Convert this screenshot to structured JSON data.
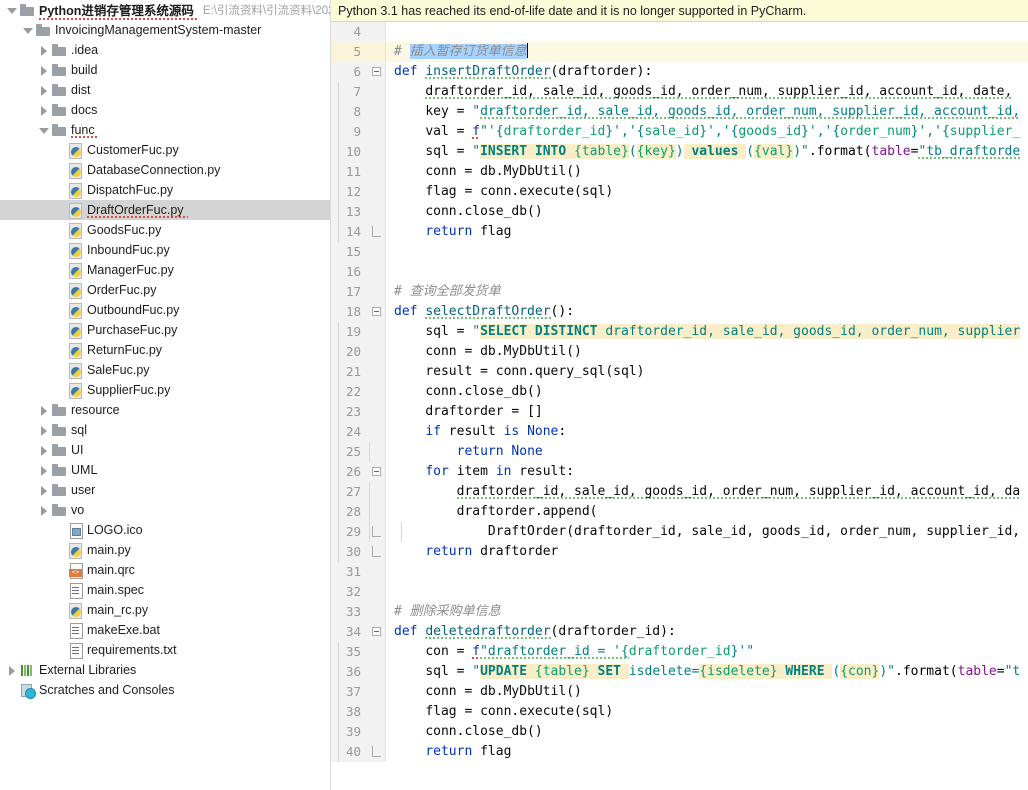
{
  "notification": {
    "message": "Python 3.1 has reached its end-of-life date and it is no longer supported in PyCharm."
  },
  "project_tree": {
    "title": "Python进销存管理系统源码",
    "path": "E:\\引流资料\\引流资料\\202",
    "items": [
      {
        "label": "Python进销存管理系统源码",
        "icon": "folder-icon",
        "arrow": "down",
        "indent": 0,
        "bold": true,
        "squiggle": true,
        "path": "E:\\引流资料\\引流资料\\202"
      },
      {
        "label": "InvoicingManagementSystem-master",
        "icon": "folder-icon",
        "arrow": "down",
        "indent": 1
      },
      {
        "label": ".idea",
        "icon": "folder-icon",
        "arrow": "right",
        "indent": 2
      },
      {
        "label": "build",
        "icon": "folder-icon",
        "arrow": "right",
        "indent": 2
      },
      {
        "label": "dist",
        "icon": "folder-icon",
        "arrow": "right",
        "indent": 2
      },
      {
        "label": "docs",
        "icon": "folder-icon",
        "arrow": "right",
        "indent": 2
      },
      {
        "label": "func",
        "icon": "folder-icon",
        "arrow": "down",
        "indent": 2,
        "squiggle": true
      },
      {
        "label": "CustomerFuc.py",
        "icon": "python-file-icon",
        "arrow": "none",
        "indent": 3
      },
      {
        "label": "DatabaseConnection.py",
        "icon": "python-file-icon",
        "arrow": "none",
        "indent": 3
      },
      {
        "label": "DispatchFuc.py",
        "icon": "python-file-icon",
        "arrow": "none",
        "indent": 3
      },
      {
        "label": "DraftOrderFuc.py",
        "icon": "python-file-icon",
        "arrow": "none",
        "indent": 3,
        "selected": true,
        "squiggle": true
      },
      {
        "label": "GoodsFuc.py",
        "icon": "python-file-icon",
        "arrow": "none",
        "indent": 3
      },
      {
        "label": "InboundFuc.py",
        "icon": "python-file-icon",
        "arrow": "none",
        "indent": 3
      },
      {
        "label": "ManagerFuc.py",
        "icon": "python-file-icon",
        "arrow": "none",
        "indent": 3
      },
      {
        "label": "OrderFuc.py",
        "icon": "python-file-icon",
        "arrow": "none",
        "indent": 3
      },
      {
        "label": "OutboundFuc.py",
        "icon": "python-file-icon",
        "arrow": "none",
        "indent": 3
      },
      {
        "label": "PurchaseFuc.py",
        "icon": "python-file-icon",
        "arrow": "none",
        "indent": 3
      },
      {
        "label": "ReturnFuc.py",
        "icon": "python-file-icon",
        "arrow": "none",
        "indent": 3
      },
      {
        "label": "SaleFuc.py",
        "icon": "python-file-icon",
        "arrow": "none",
        "indent": 3
      },
      {
        "label": "SupplierFuc.py",
        "icon": "python-file-icon",
        "arrow": "none",
        "indent": 3
      },
      {
        "label": "resource",
        "icon": "folder-icon",
        "arrow": "right",
        "indent": 2
      },
      {
        "label": "sql",
        "icon": "folder-icon",
        "arrow": "right",
        "indent": 2
      },
      {
        "label": "UI",
        "icon": "folder-icon",
        "arrow": "right",
        "indent": 2
      },
      {
        "label": "UML",
        "icon": "folder-icon",
        "arrow": "right",
        "indent": 2
      },
      {
        "label": "user",
        "icon": "folder-icon",
        "arrow": "right",
        "indent": 2
      },
      {
        "label": "vo",
        "icon": "folder-icon",
        "arrow": "right",
        "indent": 2
      },
      {
        "label": "LOGO.ico",
        "icon": "image-file-icon",
        "arrow": "none",
        "indent": 3
      },
      {
        "label": "main.py",
        "icon": "python-file-icon",
        "arrow": "none",
        "indent": 3
      },
      {
        "label": "main.qrc",
        "icon": "qrc-file-icon",
        "arrow": "none",
        "indent": 3
      },
      {
        "label": "main.spec",
        "icon": "text-file-icon",
        "arrow": "none",
        "indent": 3
      },
      {
        "label": "main_rc.py",
        "icon": "python-file-icon",
        "arrow": "none",
        "indent": 3
      },
      {
        "label": "makeExe.bat",
        "icon": "text-file-icon",
        "arrow": "none",
        "indent": 3
      },
      {
        "label": "requirements.txt",
        "icon": "text-file-icon",
        "arrow": "none",
        "indent": 3
      },
      {
        "label": "External Libraries",
        "icon": "external-libraries-icon",
        "arrow": "right",
        "indent": 0
      },
      {
        "label": "Scratches and Consoles",
        "icon": "scratches-icon",
        "arrow": "none",
        "indent": 0
      }
    ]
  },
  "editor": {
    "file": "DraftOrderFuc.py",
    "first_line_number": 4,
    "current_line": 5,
    "selection_text": "插入暂存订货单信息",
    "lines": [
      {
        "n": 4,
        "fold": "",
        "indent": 0,
        "html": ""
      },
      {
        "n": 5,
        "fold": "",
        "indent": 0,
        "current": true,
        "html": "<span class=\"cmt\">#</span> <span class=\"sel cmt\">插入暂存订货单信息</span><span class=\"caret\"></span>"
      },
      {
        "n": 6,
        "fold": "start",
        "indent": 0,
        "html": "<span class=\"kw\">def</span> <span class=\"fn squig\">insertDraftOrder</span>(<span class=\"plain\">draftorder</span>):"
      },
      {
        "n": 7,
        "fold": "",
        "indent": 1,
        "html": "    <span class=\"plain squig\">draftorder_id, sale_id, goods_id, order_num, supplier_id, account_id, date,</span>"
      },
      {
        "n": 8,
        "fold": "",
        "indent": 1,
        "html": "    <span class=\"plain\">key</span> = <span class=\"str\">\"</span><span class=\"str squig\">draftorder_id, sale_id, goods_id, order_num, supplier_id, account_id,</span>"
      },
      {
        "n": 9,
        "fold": "",
        "indent": 1,
        "html": "    <span class=\"plain\">val</span> = <span class=\"fpfx squigr\">f</span><span class=\"str\">\"'{</span><span class=\"sqlph\">draftorder_id</span><span class=\"str\">}','{</span><span class=\"sqlph\">sale_id</span><span class=\"str\">}','{</span><span class=\"sqlph\">goods_id</span><span class=\"str\">}','{</span><span class=\"sqlph\">order_num</span><span class=\"str\">}','{</span><span class=\"sqlph\">supplier_</span>"
      },
      {
        "n": 10,
        "fold": "",
        "indent": 1,
        "html": "    <span class=\"plain\">sql</span> = <span class=\"str\">\"</span><span class=\"strk hl\">INSERT INTO </span><span class=\"sqlph hl\">{table}</span><span class=\"str\">(</span><span class=\"sqlph hl\">{key}</span><span class=\"str\">)</span><span class=\"strk hl\"> values </span><span class=\"str\">(</span><span class=\"sqlph hl\">{val}</span><span class=\"str\">)\"</span>.format(<span class=\"param\">table</span>=<span class=\"str squig\">\"tb_draftorde</span>"
      },
      {
        "n": 11,
        "fold": "",
        "indent": 1,
        "html": "    <span class=\"plain\">conn</span> = <span class=\"plain\">db.MyDbUtil()</span>"
      },
      {
        "n": 12,
        "fold": "",
        "indent": 1,
        "html": "    <span class=\"plain\">flag</span> = <span class=\"plain\">conn.execute(sql)</span>"
      },
      {
        "n": 13,
        "fold": "",
        "indent": 1,
        "html": "    <span class=\"plain\">conn.close_db()</span>"
      },
      {
        "n": 14,
        "fold": "end",
        "indent": 1,
        "html": "    <span class=\"kw\">return</span> <span class=\"plain\">flag</span>"
      },
      {
        "n": 15,
        "fold": "",
        "indent": 0,
        "html": ""
      },
      {
        "n": 16,
        "fold": "",
        "indent": 0,
        "html": ""
      },
      {
        "n": 17,
        "fold": "",
        "indent": 0,
        "html": "<span class=\"cmt\"># 查询全部发货单</span>"
      },
      {
        "n": 18,
        "fold": "start",
        "indent": 0,
        "html": "<span class=\"kw\">def</span> <span class=\"fn squig\">selectDraftOrder</span>():"
      },
      {
        "n": 19,
        "fold": "",
        "indent": 1,
        "html": "    <span class=\"plain\">sql</span> = <span class=\"str\">\"</span><span class=\"strk hl\">SELECT DISTINCT </span><span class=\"str hl\">draftorder_id, sale_id, goods_id, order_num, supplier</span>"
      },
      {
        "n": 20,
        "fold": "",
        "indent": 1,
        "html": "    <span class=\"plain\">conn</span> = <span class=\"plain\">db.MyDbUtil()</span>"
      },
      {
        "n": 21,
        "fold": "",
        "indent": 1,
        "html": "    <span class=\"plain\">result</span> = <span class=\"plain\">conn.query_sql(sql)</span>"
      },
      {
        "n": 22,
        "fold": "",
        "indent": 1,
        "html": "    <span class=\"plain\">conn.close_db()</span>"
      },
      {
        "n": 23,
        "fold": "",
        "indent": 1,
        "html": "    <span class=\"plain\">draftorder</span> = []"
      },
      {
        "n": 24,
        "fold": "",
        "indent": 1,
        "html": "    <span class=\"kw\">if</span> <span class=\"plain\">result</span> <span class=\"kw\">is</span> <span class=\"kw\">None</span>:"
      },
      {
        "n": 25,
        "fold": "",
        "indent": 2,
        "html": "        <span class=\"kw\">return</span> <span class=\"kw\">None</span>"
      },
      {
        "n": 26,
        "fold": "start",
        "indent": 1,
        "html": "    <span class=\"kw\">for</span> <span class=\"plain\">item</span> <span class=\"kw\">in</span> <span class=\"plain\">result</span>:"
      },
      {
        "n": 27,
        "fold": "",
        "indent": 2,
        "html": "        <span class=\"plain squig\">draftorder_id, sale_id, goods_id, order_num, supplier_id, account_id, da</span>"
      },
      {
        "n": 28,
        "fold": "",
        "indent": 2,
        "html": "        <span class=\"plain\">draftorder.append(</span>"
      },
      {
        "n": 29,
        "fold": "end",
        "indent": 3,
        "html": "            <span class=\"plain\">DraftOrder(draftorder_id, sale_id, goods_id, order_num, supplier_id,</span>"
      },
      {
        "n": 30,
        "fold": "end",
        "indent": 1,
        "html": "    <span class=\"kw\">return</span> <span class=\"plain\">draftorder</span>"
      },
      {
        "n": 31,
        "fold": "",
        "indent": 0,
        "html": ""
      },
      {
        "n": 32,
        "fold": "",
        "indent": 0,
        "html": ""
      },
      {
        "n": 33,
        "fold": "",
        "indent": 0,
        "html": "<span class=\"cmt\"># 删除采购单信息</span>"
      },
      {
        "n": 34,
        "fold": "start",
        "indent": 0,
        "html": "<span class=\"kw\">def</span> <span class=\"fn squig\">deletedraftorder</span>(<span class=\"plain\">draftorder_id</span>):"
      },
      {
        "n": 35,
        "fold": "",
        "indent": 1,
        "html": "    <span class=\"plain\">con</span> = <span class=\"fpfx squigr\">f</span><span class=\"str squig\">\"draftorder_id = '{</span><span class=\"sqlph\">draftorder_id</span><span class=\"str\">}'\"</span>"
      },
      {
        "n": 36,
        "fold": "",
        "indent": 1,
        "html": "    <span class=\"plain\">sql</span> = <span class=\"str\">\"</span><span class=\"strk hl\">UPDATE </span><span class=\"sqlph hl\">{table}</span><span class=\"strk hl\"> SET </span><span class=\"str\">isdelete=</span><span class=\"sqlph hl\">{isdelete}</span><span class=\"strk hl\"> WHERE </span><span class=\"str\">(</span><span class=\"sqlph hl\">{con}</span><span class=\"str\">)\"</span>.format(<span class=\"param\">table</span>=<span class=\"str\">\"t</span>"
      },
      {
        "n": 37,
        "fold": "",
        "indent": 1,
        "html": "    <span class=\"plain\">conn</span> = <span class=\"plain\">db.MyDbUtil()</span>"
      },
      {
        "n": 38,
        "fold": "",
        "indent": 1,
        "html": "    <span class=\"plain\">flag</span> = <span class=\"plain\">conn.execute(sql)</span>"
      },
      {
        "n": 39,
        "fold": "",
        "indent": 1,
        "html": "    <span class=\"plain\">conn.close_db()</span>"
      },
      {
        "n": 40,
        "fold": "end",
        "indent": 1,
        "html": "    <span class=\"kw\">return</span> <span class=\"plain\">flag</span>"
      }
    ]
  },
  "colors": {
    "notification_bg": "#fcfbd8",
    "current_line_bg": "#fdf8e3",
    "selection_bg": "#a6d2ff",
    "gutter_bg": "#f2f2f2",
    "tree_selection_bg": "#d4d4d4",
    "keyword": "#0033b3",
    "string": "#008080",
    "comment": "#8c8c8c",
    "sql_placeholder": "#0a9e6e",
    "sql_highlight_bg": "#faeec8",
    "function_name": "#00627a",
    "named_param": "#871094"
  }
}
